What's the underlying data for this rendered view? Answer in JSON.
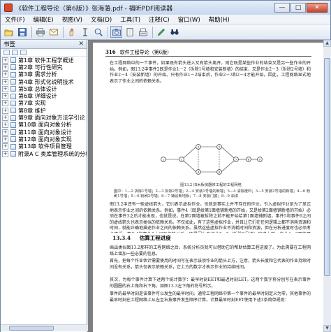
{
  "window": {
    "title": "《软件工程导论（第6版）》张海藩.pdf - 福昕PDF阅读器",
    "min": "—",
    "max": "□",
    "close": "✕"
  },
  "menu": [
    "文件(F)",
    "编辑(E)",
    "视图(V)",
    "文档(D)",
    "工具(T)",
    "注释(C)",
    "窗口(W)",
    "帮助(H)"
  ],
  "toolbar": {
    "icons": [
      "open-icon",
      "save-icon",
      "print-icon",
      "email-icon",
      "hand-icon",
      "select-text-icon",
      "zoom-icon",
      "snapshot-icon",
      "fit-page-icon",
      "typewriter-icon",
      "pen-icon",
      "search-icon"
    ]
  },
  "sidebar": {
    "title": "书签",
    "close": "✕",
    "items": [
      {
        "label": "第1章 软件工程学概述",
        "expanded": false
      },
      {
        "label": "第2章 可行性研究",
        "expanded": false
      },
      {
        "label": "第3章 需求分析",
        "expanded": false
      },
      {
        "label": "第4章 形式化说明技术",
        "expanded": false
      },
      {
        "label": "第5章 总体设计",
        "expanded": false
      },
      {
        "label": "第6章 详细设计",
        "expanded": false
      },
      {
        "label": "第7章 实现",
        "expanded": false
      },
      {
        "label": "第8章 维护",
        "expanded": false
      },
      {
        "label": "第9章 面向对象方法学引论",
        "expanded": false
      },
      {
        "label": "第10章 面向对象分析",
        "expanded": false
      },
      {
        "label": "第11章 面向对象设计",
        "expanded": false
      },
      {
        "label": "第12章 面向对象实现",
        "expanded": false
      },
      {
        "label": "第13章 软件项目管理",
        "expanded": false
      },
      {
        "label": "附录A C 类库管理系统的分析与设计",
        "expanded": false
      }
    ]
  },
  "page": {
    "number": "316",
    "running_header": "软件工程导论（第6版）",
    "para1": "在工程网络中的一个事件，如果既有箭头进入又有箭头离开，则它既是某些作业的结束又是另一些作业的开始。例如，图13.2中事件2既是作业1－2（拆除1号墙和安装新墙）的结束，又是作业2－3（拆除2号墙）和作业2－4（安装新墙）的开始。只有作业1－2结束后，作业2－3和2－4才能开始。因此，工程网络显式地表示了作业之间的依赖关系。",
    "figure_caption": "图13.2 旧木板房翻修工程的工程网络",
    "figure_note": "图中：1—2 拆除1号墙；2—3 拆除2号墙；2—4 安装1号墙的新墙；3—4 清除废料；3—5 安装2号墙的新墙；4—6 粉刷1号墙；5—6 粉刷2号墙；6—7 铺设新地板；7—8 安装门窗；8—9 油漆",
    "para2": "图13.2中还有一些虚线箭头，它们表示虚拟作业，也就是事实上并不存在的作业。引入虚拟作业是为了显式地表示作业之间的依赖关系。例如，事件4（既是给第1面墙铺新墙的开始，又是给第2面墙铺新墙的开始）必须在事件3之后才能出现，也就是说，在第2面墙被拆除之前不能开始给第1面墙铺新墙。事件5和事件6之间的虚线箭头也表示类似的依赖关系。不仅如此，有了这些虚拟作业，并且让它们在任何逻辑上都不消耗资源和时间，就能正确地描述作业之间的依赖关系。虽然这些虚拟作业不消耗时间和资源，但在分析进度时也必须考虑它们。事件4和事件6之间有依赖关系，这是因为在作业2－3（拆除2号墙）完成之前，作业4－6不能开始。也就是说，只有在2号墙拆除之后，1号墙才能开始粉刷。这就是这个工程网络中需要引入虚拟作业的原因。",
    "section_number": "13.3.4",
    "section_title": "估算工程进度",
    "para3": "画出类似图13.2那样的工程网络之后，系统分析员就可以借助它的帮助估算工程进度了。为此需要在工程网络上增加一些必要的信息。",
    "para4": "首先，把每个作业估计需要使用的时间写在表示该项作业的箭头上方，注意，箭头长度和它代表的作业持续时间没有关系，箭头仅表示依赖关系，它上方的数字才表示作业的持续时间。",
    "para5": "其次，为每个事件计算下述两个统计数字：最早时刻EET和最迟时刻LET。这两个数字将分别写在表示事件的圆圈的右上角和右下角，如图13.3左下角的符号所示。",
    "para6": "事件的最早时刻是该事件可以发生的最早时间。通常工程网络中第一个事件的最早时刻定义为零，其他事件的最早时刻在工程网络上从左至右按事件发生顺序计算。计算最早时刻EET使用下述3条简单规则："
  },
  "diagram": {
    "nodes": [
      "1",
      "2",
      "3",
      "4",
      "5",
      "6",
      "7",
      "8",
      "9"
    ]
  }
}
